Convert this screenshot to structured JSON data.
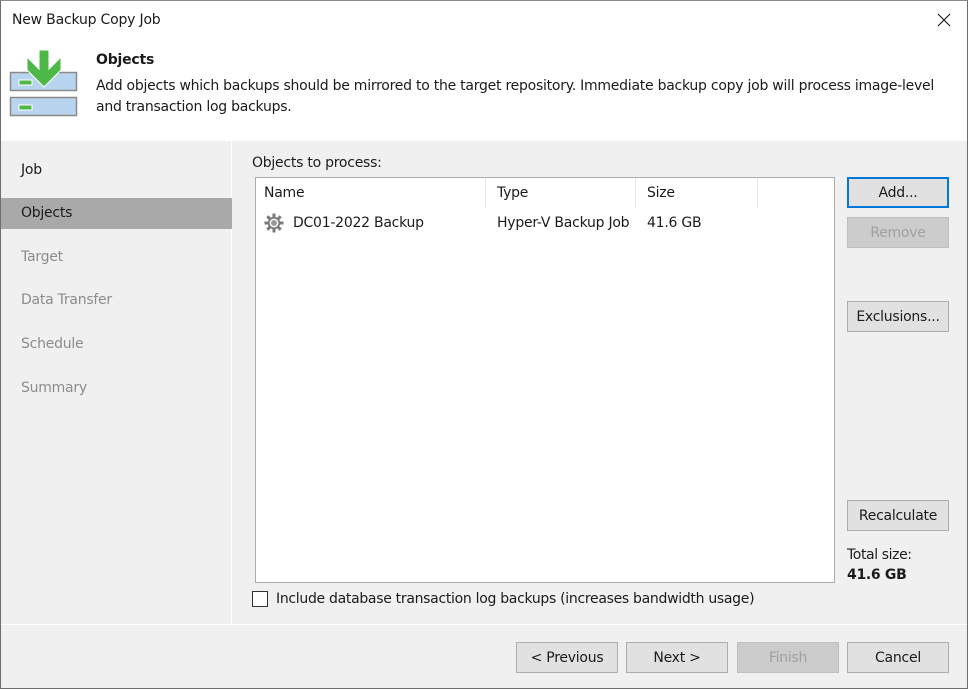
{
  "window": {
    "title": "New Backup Copy Job",
    "close_icon": "close-icon"
  },
  "header": {
    "icon": "backup-copy-download-icon",
    "title": "Objects",
    "description": "Add objects which backups should be mirrored to the target repository. Immediate backup copy job will process image-level and transaction log backups."
  },
  "sidebar": {
    "items": [
      {
        "label": "Job",
        "state": "done"
      },
      {
        "label": "Objects",
        "state": "active"
      },
      {
        "label": "Target",
        "state": "pending"
      },
      {
        "label": "Data Transfer",
        "state": "pending"
      },
      {
        "label": "Schedule",
        "state": "pending"
      },
      {
        "label": "Summary",
        "state": "pending"
      }
    ]
  },
  "objects": {
    "label": "Objects to process:",
    "columns": [
      "Name",
      "Type",
      "Size"
    ],
    "rows": [
      {
        "icon": "gear-icon",
        "name": "DC01-2022 Backup",
        "type": "Hyper-V Backup Job",
        "size": "41.6 GB"
      }
    ]
  },
  "side_buttons": {
    "add": "Add...",
    "remove": "Remove",
    "exclusions": "Exclusions...",
    "recalculate": "Recalculate"
  },
  "total": {
    "label": "Total size:",
    "value": "41.6 GB"
  },
  "options": {
    "include_log_backups": {
      "label": "Include database transaction log backups (increases bandwidth usage)",
      "checked": false
    }
  },
  "footer": {
    "previous": "< Previous",
    "next": "Next >",
    "finish": "Finish",
    "cancel": "Cancel"
  },
  "colors": {
    "accent_focus": "#0078d7",
    "icon_green": "#4db848",
    "icon_blue": "#b9d4ee",
    "active_step_bg": "#a9a9a9"
  }
}
